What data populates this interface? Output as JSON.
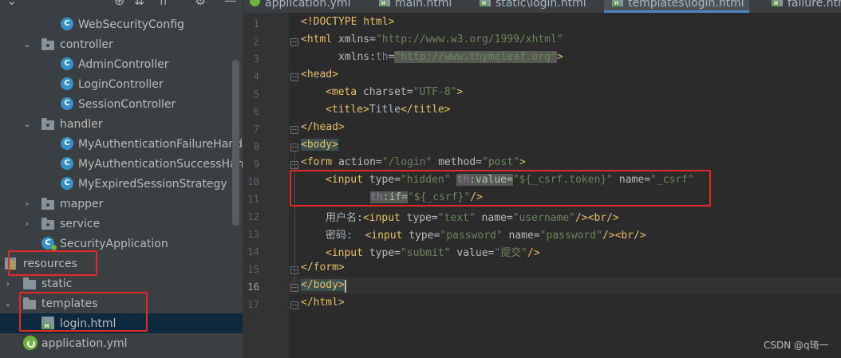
{
  "project_tree": {
    "items": [
      {
        "label": "WebSecurityConfig",
        "type": "class"
      },
      {
        "label": "controller",
        "type": "package",
        "expanded": true
      },
      {
        "label": "AdminController",
        "type": "class"
      },
      {
        "label": "LoginController",
        "type": "class"
      },
      {
        "label": "SessionController",
        "type": "class"
      },
      {
        "label": "handler",
        "type": "package",
        "expanded": true
      },
      {
        "label": "MyAuthenticationFailureHandl",
        "type": "class"
      },
      {
        "label": "MyAuthenticationSuccessHanc",
        "type": "class"
      },
      {
        "label": "MyExpiredSessionStrategy",
        "type": "class"
      },
      {
        "label": "mapper",
        "type": "package",
        "expanded": false
      },
      {
        "label": "service",
        "type": "package",
        "expanded": false
      },
      {
        "label": "SecurityApplication",
        "type": "spring-class"
      },
      {
        "label": "resources",
        "type": "resources-folder",
        "expanded": true
      },
      {
        "label": "static",
        "type": "folder",
        "expanded": false
      },
      {
        "label": "templates",
        "type": "folder",
        "expanded": true
      },
      {
        "label": "login.html",
        "type": "html-file",
        "selected": true
      },
      {
        "label": "application.yml",
        "type": "spring-config"
      }
    ]
  },
  "tabs": [
    {
      "label": "application.yml",
      "icon": "spring-icon"
    },
    {
      "label": "main.html",
      "icon": "html-icon"
    },
    {
      "label": "static\\login.html",
      "icon": "html-icon"
    },
    {
      "label": "templates\\login.html",
      "icon": "html-icon",
      "active": true
    },
    {
      "label": "failure.htm",
      "icon": "html-icon"
    }
  ],
  "editor": {
    "current_line": 16,
    "line_numbers": [
      "1",
      "2",
      "3",
      "4",
      "5",
      "6",
      "7",
      "8",
      "9",
      "10",
      "11",
      "12",
      "13",
      "14",
      "15",
      "16",
      "17"
    ],
    "lines": {
      "l1": {
        "t1": "<!DOCTYPE ",
        "t2": "html",
        "t3": ">"
      },
      "l2": {
        "t1": "<html ",
        "t2": "xmlns=",
        "t3": "\"http://www.w3.org/1999/xhtml\""
      },
      "l3": {
        "t1": "xmlns:",
        "t2": "th",
        "t3": "=",
        "t4": "\"http://www.thymeleaf.org\"",
        "t5": ">"
      },
      "l4": {
        "t1": "<head>"
      },
      "l5": {
        "t1": "<meta ",
        "t2": "charset=",
        "t3": "\"UTF-8\"",
        "t4": ">"
      },
      "l6": {
        "t1": "<title>",
        "t2": "Title",
        "t3": "</title>"
      },
      "l7": {
        "t1": "</head>"
      },
      "l8": {
        "t1": "<body>"
      },
      "l9": {
        "t1": "<form ",
        "t2": "action=",
        "t3": "\"/login\"",
        "t4": " method=",
        "t5": "\"post\"",
        "t6": ">"
      },
      "l10": {
        "t1": "<input ",
        "t2": "type=",
        "t3": "\"hidden\"",
        "t4": " ",
        "t5": "th",
        "t6": ":value=",
        "t7": "\"${_csrf.token}\"",
        "t8": " name=",
        "t9": "\"_csrf\""
      },
      "l11": {
        "t1": "th",
        "t2": ":if=",
        "t3": "\"${_csrf}\"",
        "t4": "/>"
      },
      "l12": {
        "t1": "用户名:",
        "t2": "<input ",
        "t3": "type=",
        "t4": "\"text\"",
        "t5": " name=",
        "t6": "\"username\"",
        "t7": "/><br/>"
      },
      "l13": {
        "t1": "密码:  ",
        "t2": "<input ",
        "t3": "type=",
        "t4": "\"password\"",
        "t5": " name=",
        "t6": "\"password\"",
        "t7": "/><br/>"
      },
      "l14": {
        "t1": "<input ",
        "t2": "type=",
        "t3": "\"submit\"",
        "t4": " value=",
        "t5": "\"提交\"",
        "t6": "/>"
      },
      "l15": {
        "t1": "</form>"
      },
      "l16": {
        "t1": "</body>"
      },
      "l17": {
        "t1": "</html>"
      }
    }
  },
  "watermark": "CSDN @q琦一",
  "colors": {
    "highlight_box": "#e52828",
    "tag": "#e8bf6a",
    "string": "#6a8759",
    "attribute": "#bababa",
    "namespace": "#9876aa"
  }
}
